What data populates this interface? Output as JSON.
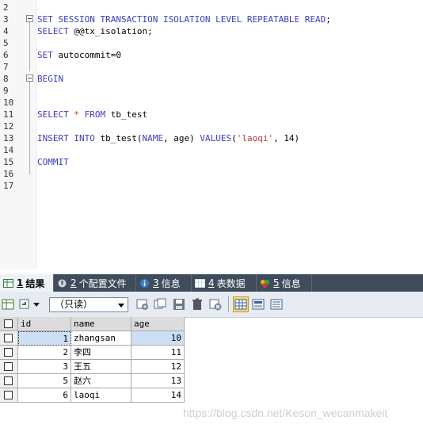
{
  "editor": {
    "line_numbers": [
      "2",
      "3",
      "4",
      "5",
      "6",
      "7",
      "8",
      "9",
      "10",
      "11",
      "12",
      "13",
      "14",
      "15",
      "16",
      "17"
    ],
    "lines": {
      "l3": [
        "SET SESSION TRANSACTION ISOLATION LEVEL REPEATABLE READ",
        ";"
      ],
      "l4": [
        "SELECT",
        " @@tx_isolation;"
      ],
      "l6": [
        "SET",
        " autocommit=0"
      ],
      "l8": [
        "BEGIN"
      ],
      "l11": [
        "SELECT",
        " * ",
        "FROM",
        " tb_test"
      ],
      "l13": [
        "INSERT INTO",
        " tb_test(",
        "NAME",
        ", age) ",
        "VALUES",
        "(",
        "'laoqi'",
        ", 14)"
      ],
      "l15": [
        "COMMIT"
      ]
    }
  },
  "tabs": [
    {
      "num": "1",
      "label": "结果",
      "icon": "result-grid-icon",
      "active": true
    },
    {
      "num": "2",
      "label": "个配置文件",
      "icon": "profile-icon",
      "active": false
    },
    {
      "num": "3",
      "label": "信息",
      "icon": "info-icon",
      "active": false
    },
    {
      "num": "4",
      "label": "表数据",
      "icon": "table-data-icon",
      "active": false
    },
    {
      "num": "5",
      "label": "信息",
      "icon": "info-colored-icon",
      "active": false
    }
  ],
  "toolbar": {
    "mode_select": "（只读）"
  },
  "grid": {
    "columns": [
      "id",
      "name",
      "age"
    ],
    "rows": [
      {
        "id": "1",
        "name": "zhangsan",
        "age": "10",
        "selected": true
      },
      {
        "id": "2",
        "name": "李四",
        "age": "11",
        "selected": false
      },
      {
        "id": "3",
        "name": "王五",
        "age": "12",
        "selected": false
      },
      {
        "id": "5",
        "name": "赵六",
        "age": "13",
        "selected": false
      },
      {
        "id": "6",
        "name": "laoqi",
        "age": "14",
        "selected": false
      }
    ]
  },
  "watermark": "https://blog.csdn.net/Keson_wecanmakeit",
  "colors": {
    "keyword": "#3d3dbf",
    "string": "#b04040",
    "tabbar": "#3f4c5c",
    "toolbar": "#e6ebf2",
    "selection": "#cddff5"
  }
}
